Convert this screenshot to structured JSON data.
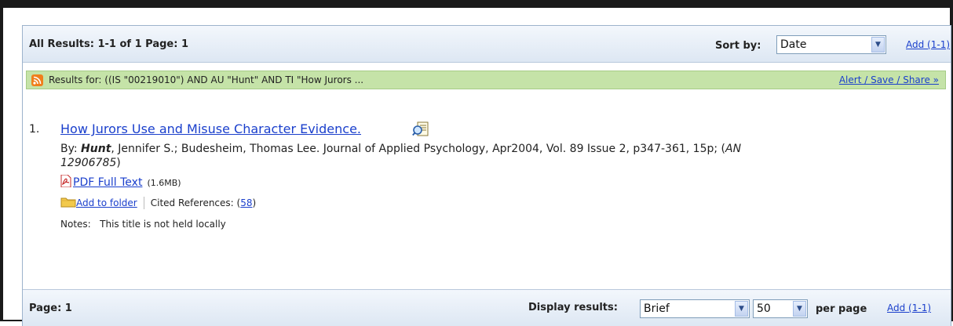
{
  "header": {
    "summary": "All Results: 1-1 of 1   Page: 1",
    "sort_label": "Sort by:",
    "sort_value": "Date",
    "add_link": "Add (1-1)"
  },
  "query_bar": {
    "results_for": "Results for: ((IS \"00219010\") AND AU \"Hunt\" AND TI \"How Jurors ...",
    "alert_link": "Alert / Save / Share »",
    "icon": "rss-icon"
  },
  "record": {
    "number": "1.",
    "title": "How Jurors Use and Misuse Character Evidence.",
    "by_label": "By:",
    "author_bold": "Hunt",
    "byline_rest": ", Jennifer S.; Budesheim, Thomas Lee. Journal of Applied Psychology, Apr2004, Vol. 89 Issue 2, p347-361, 15p; (",
    "an_label": "AN",
    "an_value": "12906785",
    "pdf_label": "PDF Full Text",
    "pdf_size": "(1.6MB)",
    "add_folder": "Add to folder",
    "cited_label": "Cited References: (",
    "cited_count": "58",
    "cited_close": ")",
    "notes_label": "Notes:",
    "notes_text": "This title is not held locally"
  },
  "footer": {
    "page_label": "Page: 1",
    "display_label": "Display results:",
    "display_value": "Brief",
    "per_page_value": "50",
    "per_page_label": "per page",
    "add_link": "Add (1-1)"
  },
  "colors": {
    "link": "#1a3fcc",
    "query_bar_bg": "#c5e3a8",
    "toolbar_bg": "#dde7f3"
  }
}
